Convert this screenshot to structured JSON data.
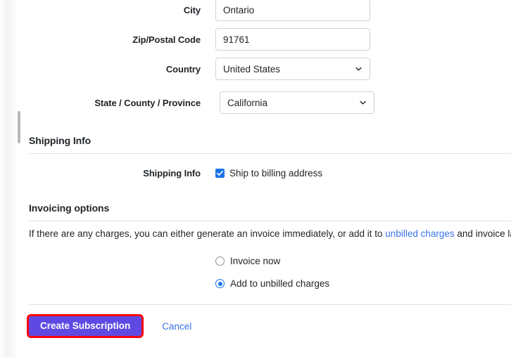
{
  "form": {
    "fields": [
      {
        "label": "City",
        "type": "text",
        "value": "Ontario"
      },
      {
        "label": "Zip/Postal Code",
        "type": "text",
        "value": "91761"
      },
      {
        "label": "Country",
        "type": "select",
        "value": "United States"
      },
      {
        "label": "State / County / Province",
        "type": "select",
        "value": "California"
      }
    ]
  },
  "shipping_section": {
    "heading": "Shipping Info",
    "row_label": "Shipping Info",
    "checkbox_label": "Ship to billing address",
    "checkbox_checked": true,
    "checkbox_icon": "checkmark-icon"
  },
  "invoicing_section": {
    "heading": "Invoicing options",
    "help_prefix": "If there are any charges, you can either generate an invoice immediately, or add it to ",
    "help_link": "unbilled charges",
    "help_suffix": " and invoice later.",
    "options": [
      {
        "label": "Invoice now",
        "selected": false
      },
      {
        "label": "Add to unbilled charges",
        "selected": true
      }
    ]
  },
  "actions": {
    "primary_label": "Create Subscription",
    "cancel_label": "Cancel"
  },
  "colors": {
    "primary_button_bg": "#5e4ae3",
    "highlight_outline": "#fb0007",
    "link": "#3b74e8",
    "control_selected": "#1a73e8",
    "input_border": "#ced4da",
    "divider": "#dee2e6",
    "text": "#212529",
    "scrollbar_thumb": "#b9b9b9"
  },
  "icons": {
    "select_caret": "chevron-down-icon",
    "scrollbar": "vertical-scrollbar"
  }
}
